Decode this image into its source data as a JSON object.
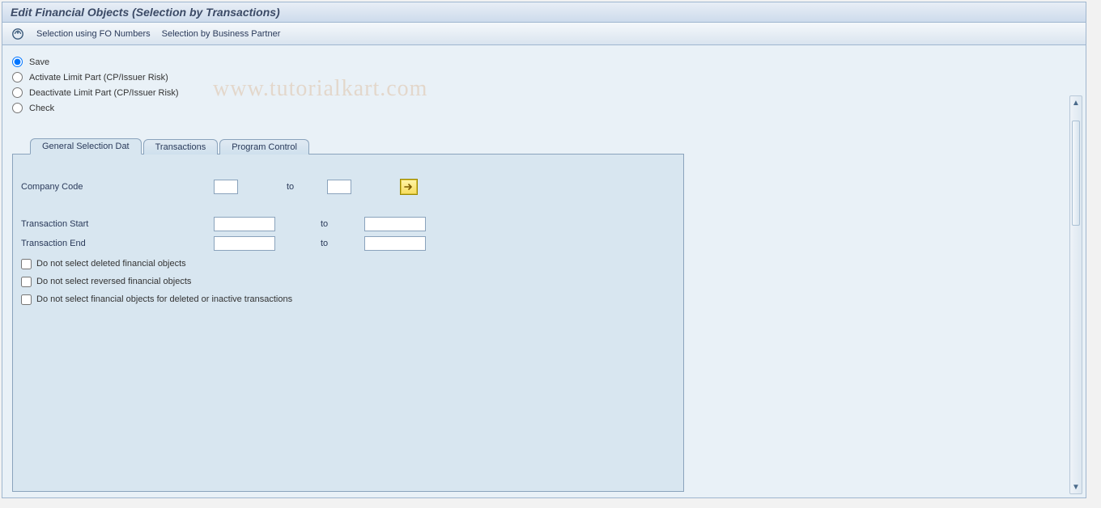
{
  "title": "Edit Financial Objects (Selection by Transactions)",
  "toolbar": {
    "execute_icon": "execute-icon",
    "link_fo_numbers": "Selection using FO Numbers",
    "link_bp": "Selection by Business Partner"
  },
  "radios": {
    "save": "Save",
    "activate": "Activate Limit Part (CP/Issuer Risk)",
    "deactivate": "Deactivate Limit Part (CP/Issuer Risk)",
    "check": "Check",
    "selected": "save"
  },
  "tabs": {
    "general": "General Selection Dat",
    "transactions": "Transactions",
    "program": "Program Control",
    "active": "general"
  },
  "form": {
    "company_code_label": "Company Code",
    "to_label": "to",
    "transaction_start_label": "Transaction Start",
    "transaction_end_label": "Transaction End",
    "company_code_from": "",
    "company_code_to": "",
    "tx_start_from": "",
    "tx_start_to": "",
    "tx_end_from": "",
    "tx_end_to": "",
    "multi_select_icon": "arrow-right-icon"
  },
  "checks": {
    "no_deleted": "Do not select deleted financial objects",
    "no_reversed": "Do not select reversed financial objects",
    "no_inactive": "Do not select financial objects for deleted or inactive transactions"
  },
  "watermark": "www.tutorialkart.com"
}
